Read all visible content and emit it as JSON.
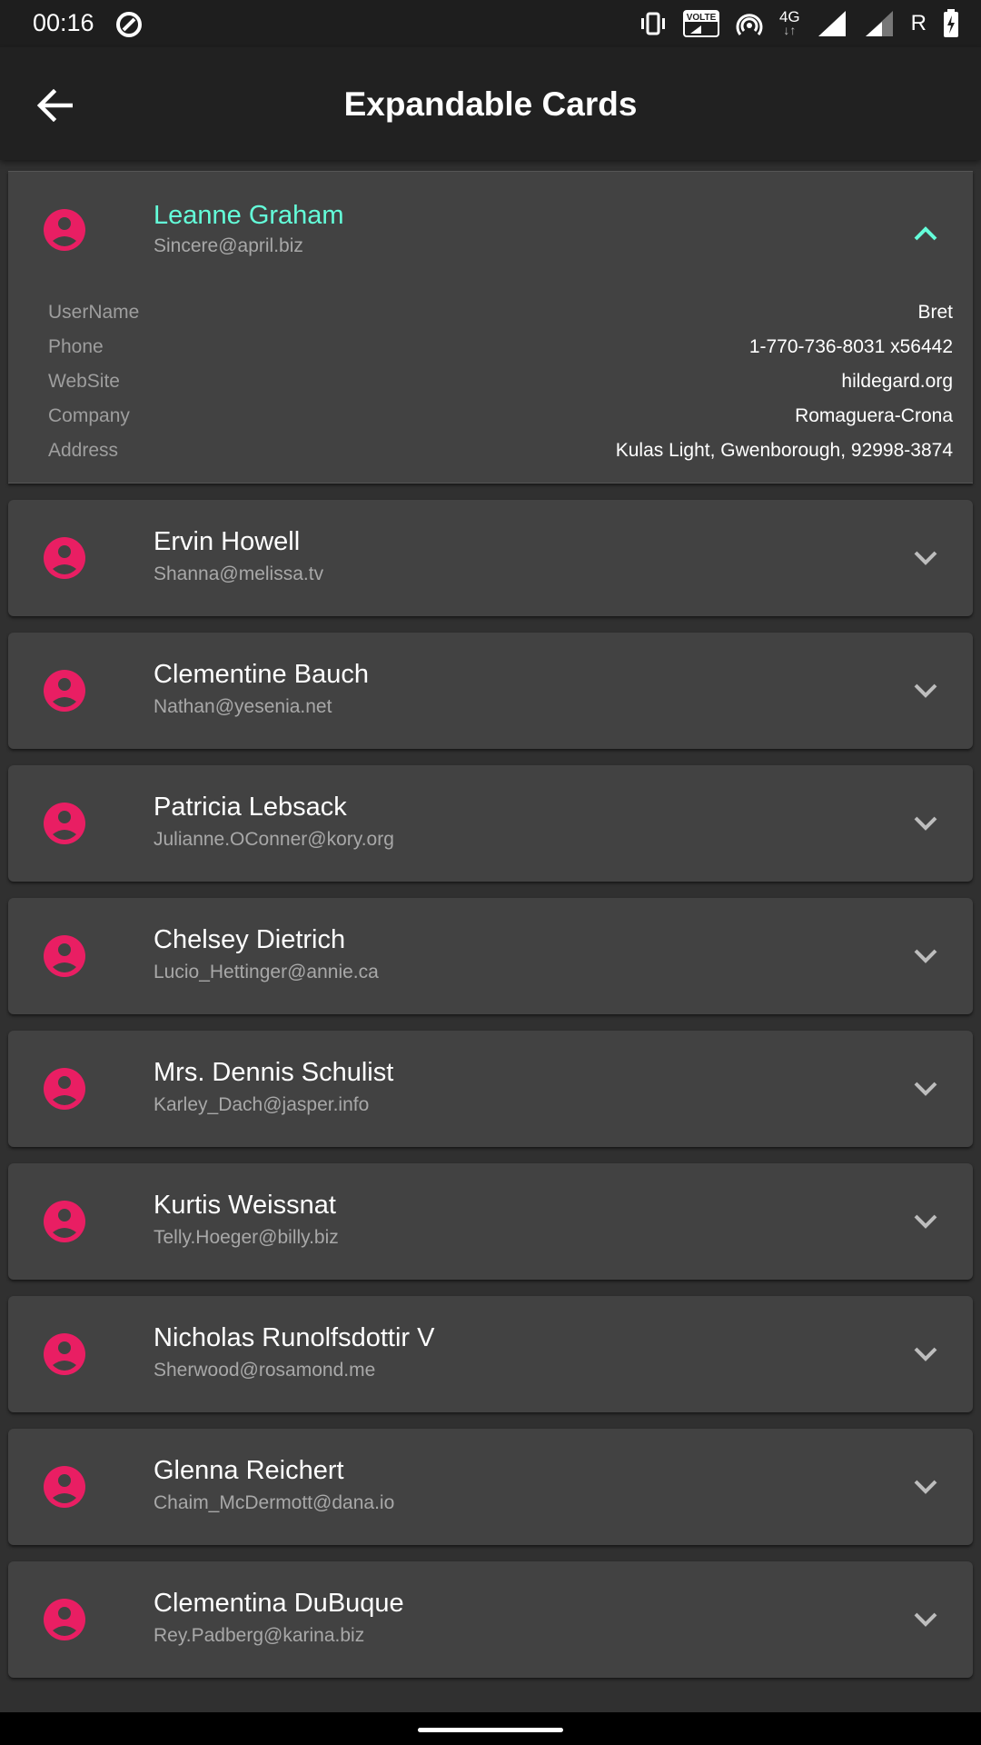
{
  "status_bar": {
    "time": "00:16",
    "network_label": "4G",
    "volte_label": "VOLTE",
    "roaming_label": "R",
    "icons": [
      "data-saver-icon",
      "vibrate-icon",
      "volte-icon",
      "hotspot-icon",
      "network-4g-icon",
      "signal-icon",
      "signal-icon",
      "battery-charging-icon"
    ]
  },
  "app_bar": {
    "title": "Expandable Cards",
    "back_icon": "arrow-back-icon"
  },
  "theme": {
    "accent": "#64ffda",
    "avatar_color": "#e91e63",
    "card_bg": "#424242",
    "page_bg": "#303030"
  },
  "expanded_user": {
    "name": "Leanne Graham",
    "email": "Sincere@april.biz",
    "details": [
      {
        "label": "UserName",
        "value": "Bret"
      },
      {
        "label": "Phone",
        "value": "1-770-736-8031 x56442"
      },
      {
        "label": "WebSite",
        "value": "hildegard.org"
      },
      {
        "label": "Company",
        "value": "Romaguera-Crona"
      },
      {
        "label": "Address",
        "value": "Kulas Light, Gwenborough, 92998-3874"
      }
    ]
  },
  "users": [
    {
      "name": "Ervin Howell",
      "email": "Shanna@melissa.tv"
    },
    {
      "name": "Clementine Bauch",
      "email": "Nathan@yesenia.net"
    },
    {
      "name": "Patricia Lebsack",
      "email": "Julianne.OConner@kory.org"
    },
    {
      "name": "Chelsey Dietrich",
      "email": "Lucio_Hettinger@annie.ca"
    },
    {
      "name": "Mrs. Dennis Schulist",
      "email": "Karley_Dach@jasper.info"
    },
    {
      "name": "Kurtis Weissnat",
      "email": "Telly.Hoeger@billy.biz"
    },
    {
      "name": "Nicholas Runolfsdottir V",
      "email": "Sherwood@rosamond.me"
    },
    {
      "name": "Glenna Reichert",
      "email": "Chaim_McDermott@dana.io"
    },
    {
      "name": "Clementina DuBuque",
      "email": "Rey.Padberg@karina.biz"
    }
  ]
}
